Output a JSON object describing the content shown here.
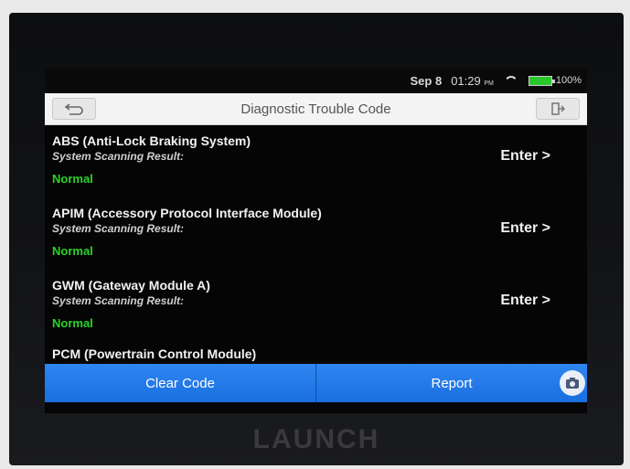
{
  "status": {
    "date": "Sep 8",
    "time": "01:29",
    "ampm": "PM",
    "battery_text": "100%"
  },
  "titlebar": {
    "title": "Diagnostic Trouble Code",
    "back_icon": "back-arrow-icon",
    "exit_icon": "exit-icon"
  },
  "modules": [
    {
      "name": "ABS (Anti-Lock Braking System)",
      "sub": "System Scanning Result:",
      "status": "Normal",
      "enter": "Enter >"
    },
    {
      "name": "APIM (Accessory Protocol Interface Module)",
      "sub": "System Scanning Result:",
      "status": "Normal",
      "enter": "Enter >"
    },
    {
      "name": "GWM (Gateway Module A)",
      "sub": "System Scanning Result:",
      "status": "Normal",
      "enter": "Enter >"
    },
    {
      "name": "PCM (Powertrain Control Module)"
    }
  ],
  "bottombar": {
    "clear_label": "Clear Code",
    "report_label": "Report"
  },
  "brand": "LAUNCH",
  "colors": {
    "accent_blue": "#1f78ea",
    "status_green": "#2ad42a",
    "battery_green": "#29c72b"
  }
}
